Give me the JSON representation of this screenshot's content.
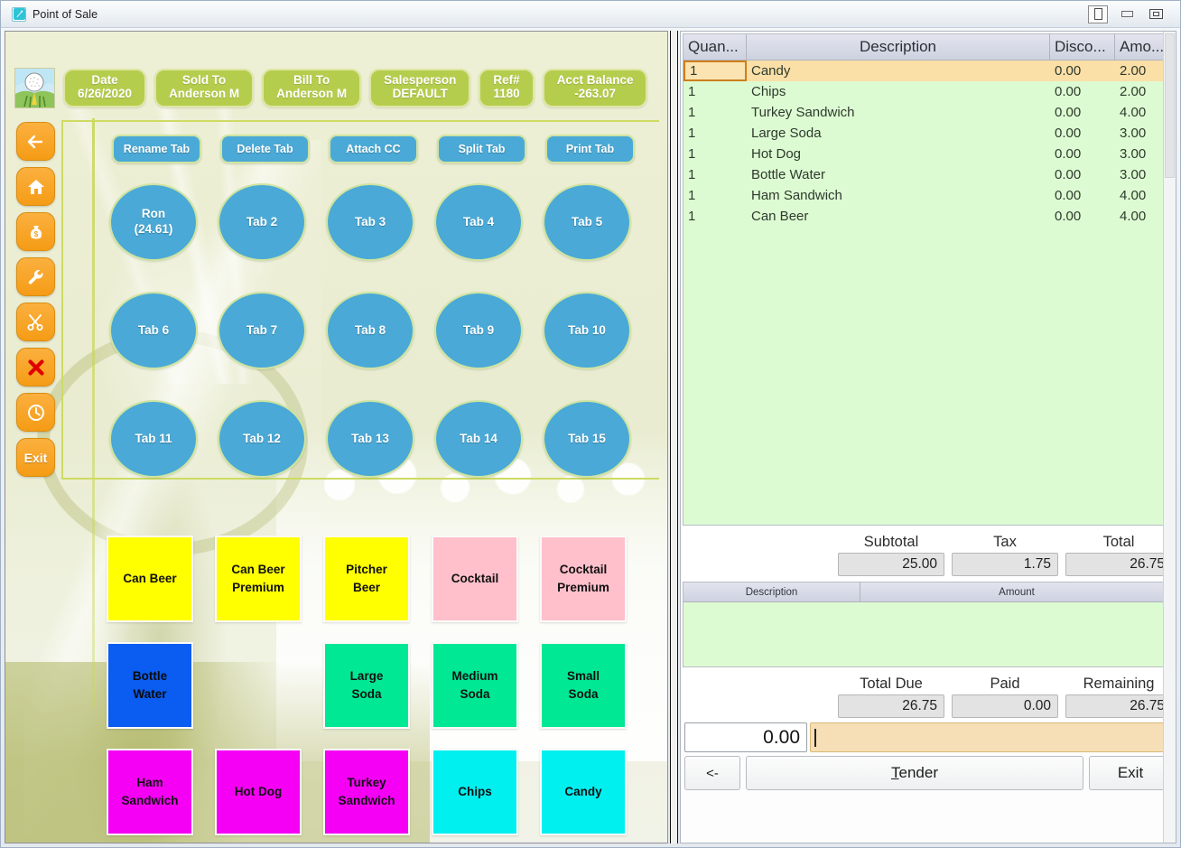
{
  "window": {
    "title": "Point of Sale",
    "app_icon": "pos-app-icon",
    "controls": [
      {
        "name": "restore-button",
        "icon": "restore-icon"
      },
      {
        "name": "minimize-button",
        "icon": "minimize-icon"
      },
      {
        "name": "maximize-button",
        "icon": "maximize-icon"
      }
    ]
  },
  "header": {
    "logo_icon": "golf-ball-logo",
    "chips": [
      {
        "label": "Date",
        "value": "6/26/2020"
      },
      {
        "label": "Sold To",
        "value": "Anderson M"
      },
      {
        "label": "Bill To",
        "value": "Anderson M"
      },
      {
        "label": "Salesperson",
        "value": "DEFAULT"
      },
      {
        "label": "Ref#",
        "value": "1180"
      },
      {
        "label": "Acct Balance",
        "value": "-263.07"
      }
    ]
  },
  "rail": [
    {
      "name": "back-arrow-button",
      "icon": "arrow-left-icon",
      "label": ""
    },
    {
      "name": "home-button",
      "icon": "home-icon",
      "label": ""
    },
    {
      "name": "cash-button",
      "icon": "money-bag-icon",
      "label": ""
    },
    {
      "name": "tools-button",
      "icon": "wrench-icon",
      "label": ""
    },
    {
      "name": "void-line-button",
      "icon": "scissors-icon",
      "label": ""
    },
    {
      "name": "cancel-button",
      "icon": "red-x-icon",
      "label": ""
    },
    {
      "name": "history-button",
      "icon": "clock-icon",
      "label": ""
    },
    {
      "name": "exit-rail-button",
      "icon": "exit-icon",
      "label": "Exit"
    }
  ],
  "tab_actions": [
    {
      "label": "Rename Tab"
    },
    {
      "label": "Delete Tab"
    },
    {
      "label": "Attach CC"
    },
    {
      "label": "Split Tab"
    },
    {
      "label": "Print Tab"
    }
  ],
  "tabs": [
    {
      "line1": "Ron",
      "line2": "(24.61)"
    },
    {
      "line1": "Tab 2",
      "line2": ""
    },
    {
      "line1": "Tab 3",
      "line2": ""
    },
    {
      "line1": "Tab 4",
      "line2": ""
    },
    {
      "line1": "Tab 5",
      "line2": ""
    },
    {
      "line1": "Tab 6",
      "line2": ""
    },
    {
      "line1": "Tab 7",
      "line2": ""
    },
    {
      "line1": "Tab 8",
      "line2": ""
    },
    {
      "line1": "Tab 9",
      "line2": ""
    },
    {
      "line1": "Tab 10",
      "line2": ""
    },
    {
      "line1": "Tab 11",
      "line2": ""
    },
    {
      "line1": "Tab 12",
      "line2": ""
    },
    {
      "line1": "Tab 13",
      "line2": ""
    },
    {
      "line1": "Tab 14",
      "line2": ""
    },
    {
      "line1": "Tab 15",
      "line2": ""
    }
  ],
  "products": [
    {
      "line1": "Can Beer",
      "line2": "",
      "color": "#ffff00"
    },
    {
      "line1": "Can Beer",
      "line2": "Premium",
      "color": "#ffff00"
    },
    {
      "line1": "Pitcher",
      "line2": "Beer",
      "color": "#ffff00"
    },
    {
      "line1": "Cocktail",
      "line2": "",
      "color": "#ffc0cb"
    },
    {
      "line1": "Cocktail",
      "line2": "Premium",
      "color": "#ffc0cb"
    },
    {
      "line1": "Bottle",
      "line2": "Water",
      "color": "#0b5cf0"
    },
    {
      "line1": "",
      "line2": "",
      "color": "none"
    },
    {
      "line1": "Large",
      "line2": "Soda",
      "color": "#00e894"
    },
    {
      "line1": "Medium",
      "line2": "Soda",
      "color": "#00e894"
    },
    {
      "line1": "Small",
      "line2": "Soda",
      "color": "#00e894"
    },
    {
      "line1": "Ham",
      "line2": "Sandwich",
      "color": "#f500f5"
    },
    {
      "line1": "Hot Dog",
      "line2": "",
      "color": "#f500f5"
    },
    {
      "line1": "Turkey",
      "line2": "Sandwich",
      "color": "#f500f5"
    },
    {
      "line1": "Chips",
      "line2": "",
      "color": "#00f0f0"
    },
    {
      "line1": "Candy",
      "line2": "",
      "color": "#00f0f0"
    }
  ],
  "items_table": {
    "headers": [
      "Quan...",
      "Description",
      "Disco...",
      "Amo..."
    ],
    "rows": [
      {
        "qty": "1",
        "desc": "Candy",
        "disc": "0.00",
        "amt": "2.00",
        "selected": true
      },
      {
        "qty": "1",
        "desc": "Chips",
        "disc": "0.00",
        "amt": "2.00",
        "selected": false
      },
      {
        "qty": "1",
        "desc": "Turkey Sandwich",
        "disc": "0.00",
        "amt": "4.00",
        "selected": false
      },
      {
        "qty": "1",
        "desc": "Large Soda",
        "disc": "0.00",
        "amt": "3.00",
        "selected": false
      },
      {
        "qty": "1",
        "desc": "Hot Dog",
        "disc": "0.00",
        "amt": "3.00",
        "selected": false
      },
      {
        "qty": "1",
        "desc": "Bottle Water",
        "disc": "0.00",
        "amt": "3.00",
        "selected": false
      },
      {
        "qty": "1",
        "desc": "Ham Sandwich",
        "disc": "0.00",
        "amt": "4.00",
        "selected": false
      },
      {
        "qty": "1",
        "desc": "Can Beer",
        "disc": "0.00",
        "amt": "4.00",
        "selected": false
      }
    ]
  },
  "totals": {
    "subtotal_label": "Subtotal",
    "subtotal_value": "25.00",
    "tax_label": "Tax",
    "tax_value": "1.75",
    "total_label": "Total",
    "total_value": "26.75"
  },
  "payments_table": {
    "headers": [
      "Description",
      "Amount"
    ],
    "rows": []
  },
  "due": {
    "total_due_label": "Total Due",
    "total_due_value": "26.75",
    "paid_label": "Paid",
    "paid_value": "0.00",
    "remaining_label": "Remaining",
    "remaining_value": "26.75"
  },
  "entry": {
    "amount_value": "0.00",
    "note_value": ""
  },
  "actions": {
    "back_label": "<-",
    "tender_label": "Tender",
    "tender_mnemonic": "T",
    "exit_label": "Exit"
  },
  "colors": {
    "chip_green": "#b5cd4d",
    "tab_blue": "#4aa9d6",
    "rail_orange": "#f9a825",
    "selected_row": "#fadfa6",
    "grid_green": "#ddfbd2",
    "note_field": "#f6dfb6"
  }
}
